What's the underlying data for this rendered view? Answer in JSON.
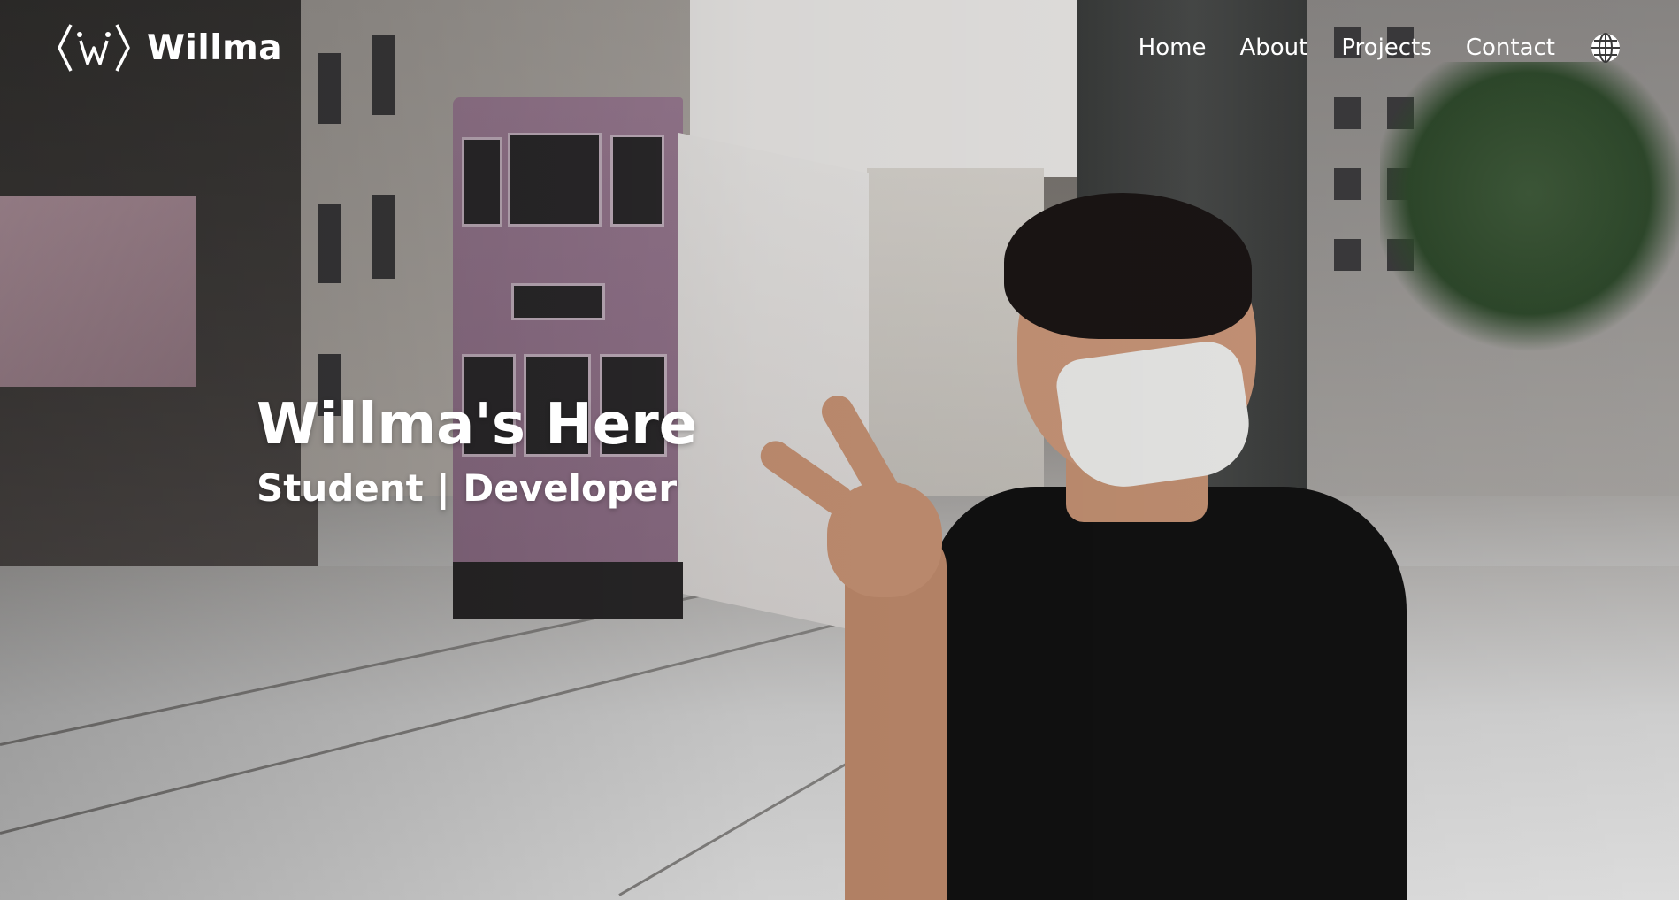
{
  "brand": {
    "name": "Willma",
    "logo_icon": "w-chevron-logo-icon"
  },
  "nav": {
    "items": [
      {
        "label": "Home"
      },
      {
        "label": "About"
      },
      {
        "label": "Projects"
      },
      {
        "label": "Contact"
      }
    ],
    "language_icon": "globe-icon"
  },
  "hero": {
    "title": "Willma's Here",
    "subtitle": "Student | Developer"
  },
  "colors": {
    "text": "#ffffff",
    "tram": "#9e7e96",
    "shirt": "#121212"
  }
}
